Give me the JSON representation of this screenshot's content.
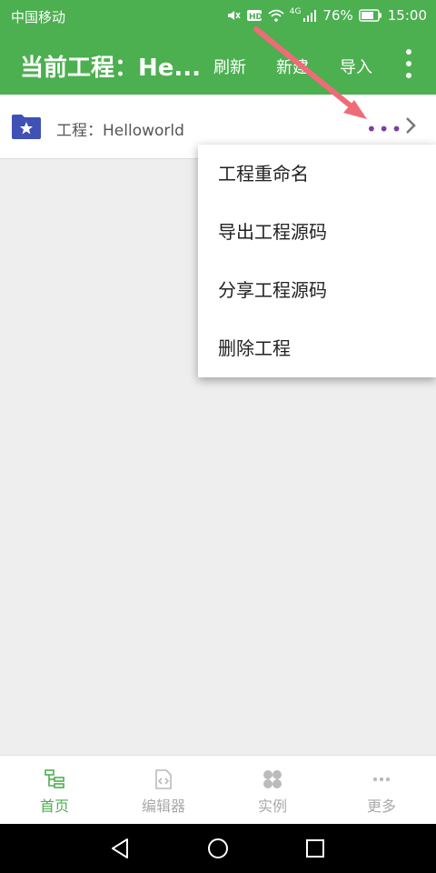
{
  "status_bar": {
    "carrier": "中国移动",
    "battery": "76%",
    "time": "15:00",
    "network": "4G"
  },
  "app_bar": {
    "title": "当前工程：He...",
    "refresh": "刷新",
    "new": "新建",
    "import": "导入"
  },
  "project": {
    "label": "工程：Helloworld"
  },
  "menu": {
    "items": [
      "工程重命名",
      "导出工程源码",
      "分享工程源码",
      "删除工程"
    ]
  },
  "bottom_nav": {
    "tabs": [
      "首页",
      "编辑器",
      "实例",
      "更多"
    ],
    "active": "首页"
  },
  "colors": {
    "primary": "#4caf50",
    "accent_dots": "#7b3fa0",
    "folder": "#3f51b5",
    "arrow": "#f06b78"
  }
}
